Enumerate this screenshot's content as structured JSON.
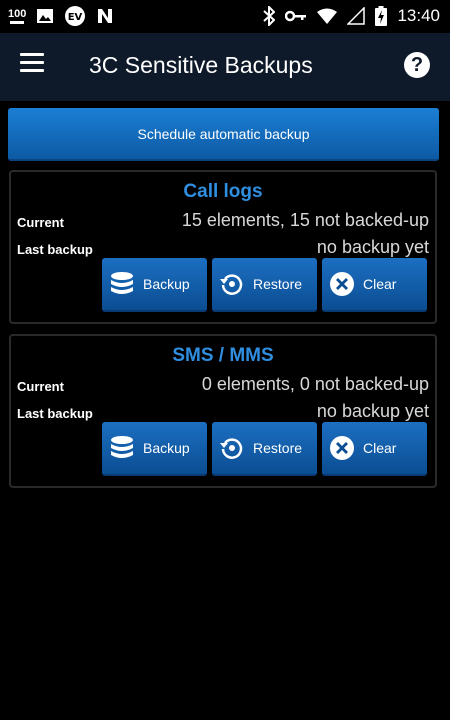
{
  "status_bar": {
    "battery_level": "100",
    "time": "13:40"
  },
  "app_bar": {
    "title": "3C Sensitive Backups"
  },
  "schedule_button": {
    "label": "Schedule automatic backup"
  },
  "sections": [
    {
      "title": "Call logs",
      "current_label": "Current",
      "current_value": "15 elements, 15 not backed-up",
      "last_backup_label": "Last backup",
      "last_backup_value": "no backup yet",
      "buttons": {
        "backup": "Backup",
        "restore": "Restore",
        "clear": "Clear"
      }
    },
    {
      "title": "SMS / MMS",
      "current_label": "Current",
      "current_value": "0 elements, 0 not backed-up",
      "last_backup_label": "Last backup",
      "last_backup_value": "no backup yet",
      "buttons": {
        "backup": "Backup",
        "restore": "Restore",
        "clear": "Clear"
      }
    }
  ],
  "colors": {
    "accent": "#2f8ee0",
    "button": "#1c6fc2",
    "app_bar": "#0e1a2a",
    "background": "#000000"
  }
}
